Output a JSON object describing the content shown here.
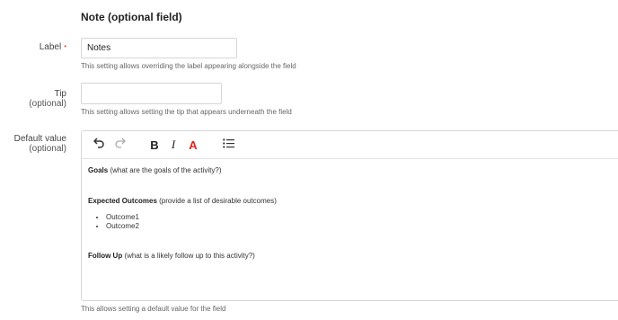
{
  "section_title": "Note (optional field)",
  "label_field": {
    "label": "Label",
    "required_marker": "•",
    "value": "Notes",
    "help": "This setting allows overriding the label appearing alongside the field"
  },
  "tip_field": {
    "label": "Tip",
    "optional": "(optional)",
    "value": "",
    "placeholder": "",
    "help": "This setting allows setting the tip that appears underneath the field"
  },
  "default_field": {
    "label": "Default value",
    "optional": "(optional)",
    "help": "This allows setting a default value for the field"
  },
  "toolbar": {
    "undo_icon": "undo-icon",
    "redo_icon": "redo-icon",
    "bold": "B",
    "italic": "I",
    "text_color": "A",
    "text_color_value": "#e02020",
    "list_icon": "bulleted-list-icon"
  },
  "editor": {
    "goals_bold": "Goals",
    "goals_rest": " (what are the goals of the activity?)",
    "outcomes_bold": "Expected Outcomes",
    "outcomes_rest": " (provide a list of desirable outcomes)",
    "outcomes": [
      "Outcome1",
      "Outcome2"
    ],
    "followup_bold": "Follow Up",
    "followup_rest": " (what is a likely follow up to this activity?)"
  }
}
